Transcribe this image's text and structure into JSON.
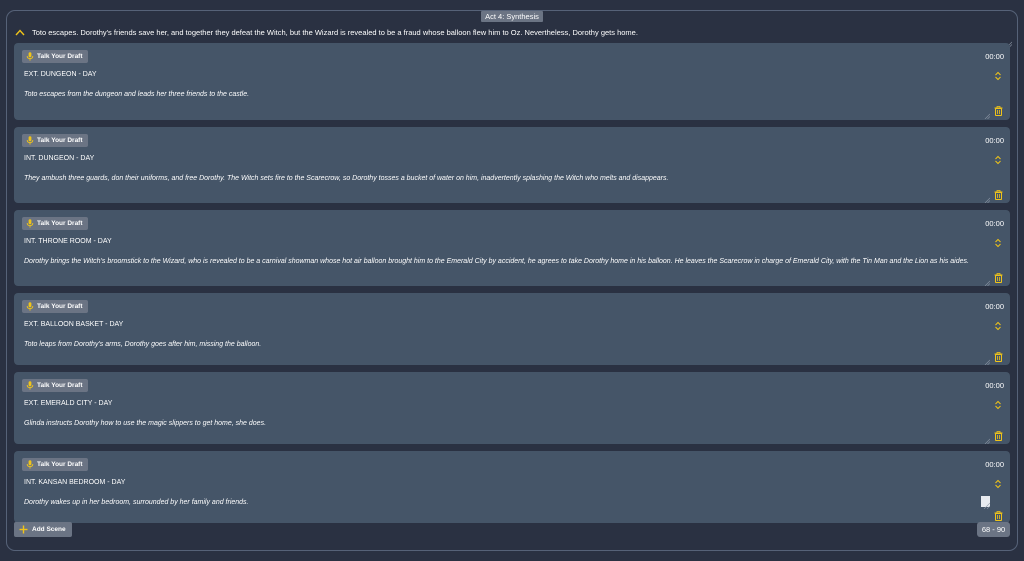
{
  "act": {
    "title": "Act 4: Synthesis",
    "summary": "Toto escapes. Dorothy's friends save her, and together they defeat the Witch, but the Wizard is revealed to be a fraud whose balloon flew him to Oz. Nevertheless, Dorothy gets home."
  },
  "talk_label": "Talk Your Draft",
  "colors": {
    "background": "#2a3142",
    "card": "#455568",
    "button": "#6b7484",
    "accent": "#f0c419"
  },
  "icons": {
    "collapse": "chevron-up-icon",
    "mic": "microphone-icon",
    "sort": "sort-arrows-icon",
    "delete": "trash-icon",
    "add": "plus-icon"
  },
  "scenes": [
    {
      "heading": "EXT. DUNGEON - DAY",
      "description": "Toto escapes from the dungeon and leads her three friends to the castle.",
      "time": "00:00"
    },
    {
      "heading": "INT. DUNGEON - DAY",
      "description": "They ambush three guards, don their uniforms, and free Dorothy. The Witch sets fire to the Scarecrow, so Dorothy tosses a bucket of water on him, inadvertently splashing the Witch who melts and disappears.",
      "time": "00:00"
    },
    {
      "heading": "INT. THRONE ROOM - DAY",
      "description": "Dorothy brings the Witch's broomstick to the Wizard, who is revealed to be a carnival showman whose hot air balloon brought him to the Emerald City by accident, he agrees to take Dorothy home in his balloon. He leaves the Scarecrow in charge of Emerald City, with the Tin Man and the Lion as his aides.",
      "time": "00:00"
    },
    {
      "heading": "EXT. BALLOON BASKET - DAY",
      "description": "Toto leaps from Dorothy's arms, Dorothy goes after him, missing the balloon.",
      "time": "00:00"
    },
    {
      "heading": "EXT. EMERALD CITY - DAY",
      "description": "Glinda instructs Dorothy how to use the magic slippers to get home, she does.",
      "time": "00:00"
    },
    {
      "heading": "INT. KANSAN BEDROOM - DAY",
      "description": "Dorothy wakes up in her bedroom, surrounded by her family and friends.",
      "time": "00:00"
    }
  ],
  "footer": {
    "add_scene_label": "Add Scene",
    "page_range": "68 - 90"
  }
}
